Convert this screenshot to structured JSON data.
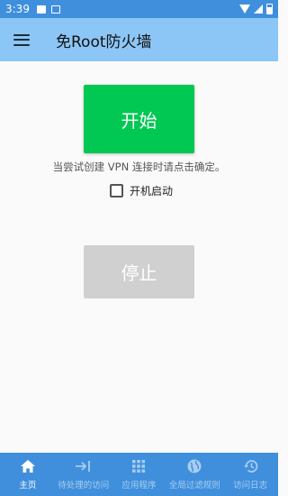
{
  "status_bar": {
    "time": "3:39"
  },
  "app_bar": {
    "title": "免Root防火墙"
  },
  "main": {
    "start_label": "开始",
    "hint": "当尝试创建 VPN 连接时请点击确定。",
    "boot_label": "开机启动",
    "boot_checked": false,
    "stop_label": "停止"
  },
  "bottom_nav": {
    "items": [
      {
        "label": "主页",
        "icon": "home-icon",
        "active": true
      },
      {
        "label": "待处理的访问",
        "icon": "login-arrow-icon",
        "active": false
      },
      {
        "label": "应用程序",
        "icon": "grid-icon",
        "active": false
      },
      {
        "label": "全局过滤规则",
        "icon": "globe-icon",
        "active": false
      },
      {
        "label": "访问日志",
        "icon": "history-icon",
        "active": false
      }
    ]
  },
  "colors": {
    "status_bar": "#3f8fdc",
    "app_bar": "#8cc6f6",
    "start_button": "#00c853",
    "stop_button": "#d0d0d0",
    "nav_bar": "#3f8fdc"
  }
}
